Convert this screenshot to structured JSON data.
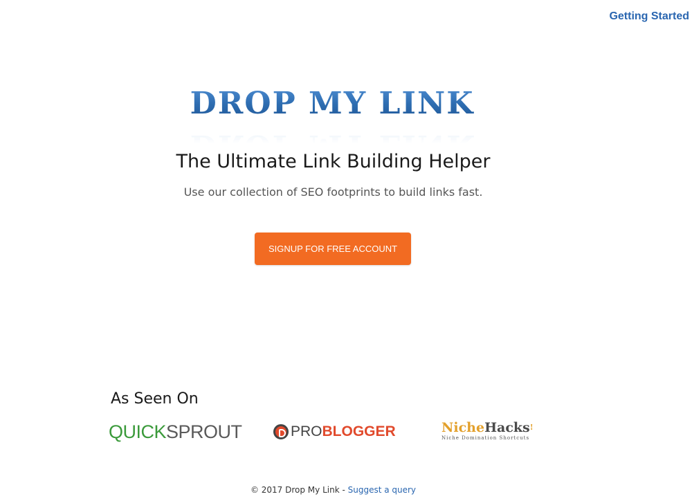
{
  "nav": {
    "getting_started": "Getting Started"
  },
  "logo": {
    "text": "DROP MY LINK"
  },
  "hero": {
    "headline": "The Ultimate Link Building Helper",
    "subline": "Use our collection of SEO footprints to build links fast.",
    "cta_label": "SIGNUP FOR FREE ACCOUNT"
  },
  "seen_on": {
    "heading": "As Seen On",
    "quicksprout": {
      "part1": "QUICK",
      "part2": "SPROUT"
    },
    "problogger": {
      "part1": "PRO",
      "part2": "BLOGGER"
    },
    "nichehacks": {
      "part1": "Niche",
      "part2": "Hacks",
      "mark": "!",
      "tagline": "Niche Domination Shortcuts"
    }
  },
  "footer": {
    "copyright": "© 2017 Drop My Link - ",
    "suggest_link": "Suggest a query"
  },
  "colors": {
    "link_blue": "#2a66b0",
    "cta_orange": "#f26b22"
  }
}
